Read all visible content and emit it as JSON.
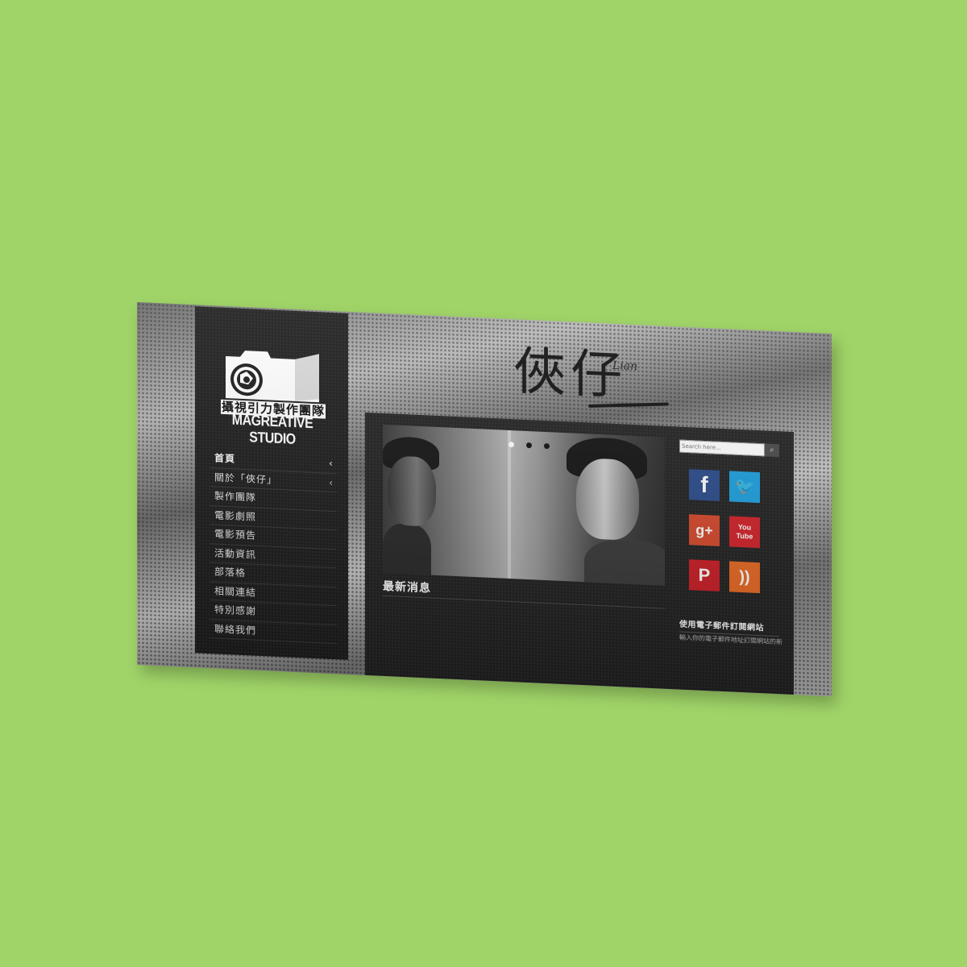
{
  "brand": {
    "name_cn": "攝視引力製作團隊",
    "name_en": "MAGREATIVE STUDIO"
  },
  "title": {
    "main": "俠仔",
    "sub": "Lian"
  },
  "nav": {
    "items": [
      {
        "label": "首頁",
        "has_submenu": true
      },
      {
        "label": "關於「俠仔」",
        "has_submenu": true
      },
      {
        "label": "製作團隊",
        "has_submenu": false
      },
      {
        "label": "電影劇照",
        "has_submenu": false
      },
      {
        "label": "電影預告",
        "has_submenu": false
      },
      {
        "label": "活動資訊",
        "has_submenu": false
      },
      {
        "label": "部落格",
        "has_submenu": false
      },
      {
        "label": "相關連結",
        "has_submenu": false
      },
      {
        "label": "特別感謝",
        "has_submenu": false
      },
      {
        "label": "聯絡我們",
        "has_submenu": false
      }
    ],
    "chevron": "‹"
  },
  "slider": {
    "slide_count": 3,
    "active_index": 0
  },
  "news": {
    "heading": "最新消息"
  },
  "search": {
    "placeholder": "Search here...",
    "button_icon": "search-icon"
  },
  "social": [
    {
      "name": "facebook",
      "glyph": "f",
      "color": "#2c4c8c"
    },
    {
      "name": "twitter",
      "glyph": "🐦",
      "color": "#1ea0e0"
    },
    {
      "name": "google-plus",
      "glyph": "g+",
      "color": "#d64a2d"
    },
    {
      "name": "youtube",
      "glyph": "You Tube",
      "color": "#d2232a"
    },
    {
      "name": "pinterest",
      "glyph": "P",
      "color": "#cc1f27"
    },
    {
      "name": "rss",
      "glyph": "))",
      "color": "#ea6a24"
    }
  ],
  "subscribe": {
    "heading": "使用電子郵件訂閱網站",
    "text": "輸入你的電子郵件地址訂閱網站的新"
  },
  "colors": {
    "page_bg": "#a0d468",
    "panel_bg": "#1c1c1c"
  }
}
